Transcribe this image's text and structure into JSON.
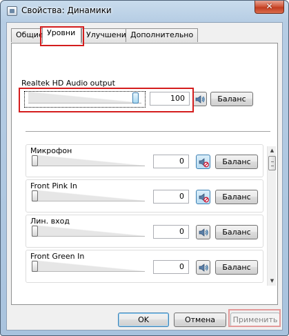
{
  "window": {
    "title": "Свойства: Динамики",
    "close_label": "✕"
  },
  "tabs": [
    {
      "label": "Общие"
    },
    {
      "label": "Уровни"
    },
    {
      "label": "Улучшения"
    },
    {
      "label": "Дополнительно"
    }
  ],
  "main_device": {
    "label": "Realtek HD Audio output",
    "value": "100",
    "level": 1.0,
    "balance_label": "Баланс"
  },
  "devices": [
    {
      "label": "Микрофон",
      "value": "0",
      "level": 0,
      "muted": true,
      "balance_label": "Баланс"
    },
    {
      "label": "Front Pink In",
      "value": "0",
      "level": 0,
      "muted": true,
      "balance_label": "Баланс"
    },
    {
      "label": "Лин. вход",
      "value": "0",
      "level": 0,
      "muted": false,
      "balance_label": "Баланс"
    },
    {
      "label": "Front Green In",
      "value": "0",
      "level": 0,
      "muted": false,
      "balance_label": "Баланс"
    }
  ],
  "footer": {
    "ok_label": "OK",
    "cancel_label": "Отмена",
    "apply_label": "Применить"
  },
  "colors": {
    "highlight_red": "#d41c1c",
    "accent_blue": "#3c7fb1"
  }
}
